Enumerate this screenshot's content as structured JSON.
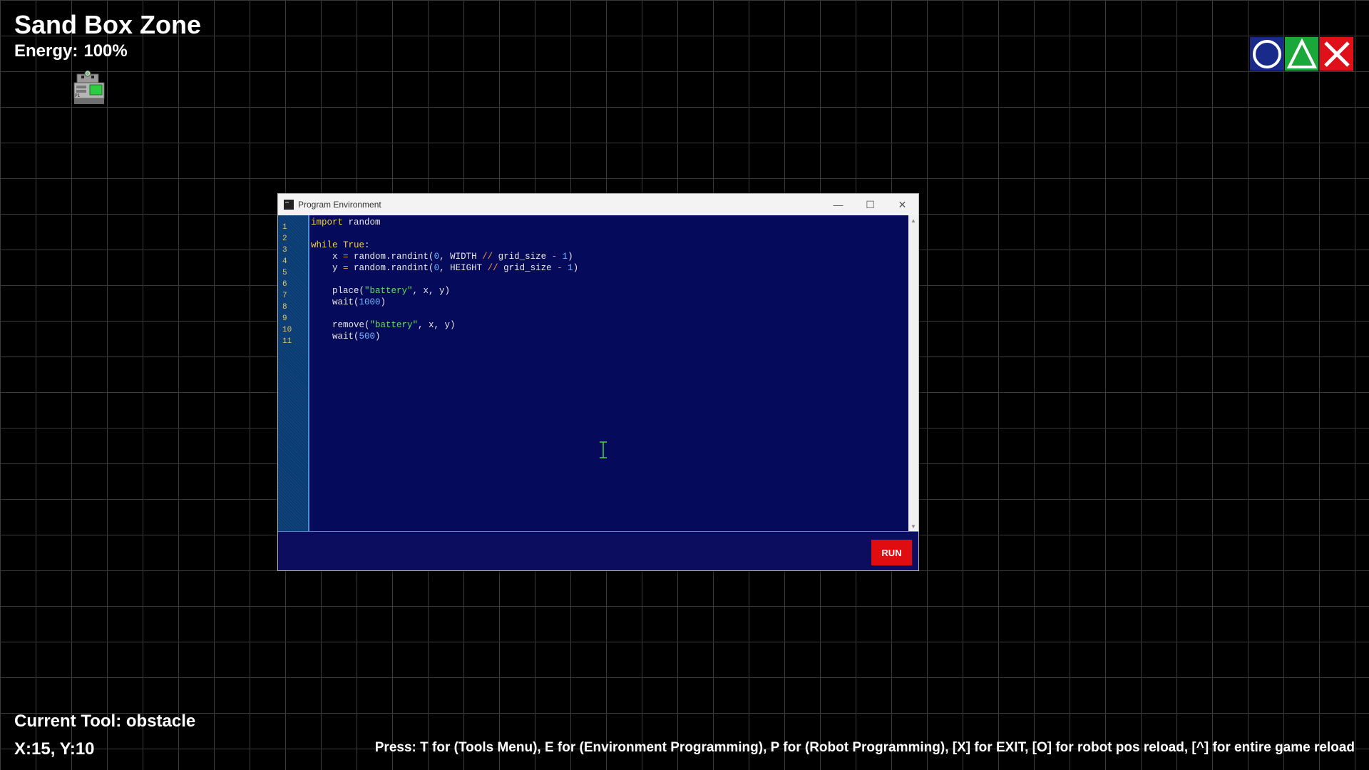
{
  "hud": {
    "title": "Sand Box Zone",
    "energy_label": "Energy:",
    "energy_value": "100%",
    "current_tool": "Current Tool: obstacle",
    "coords": "X:15, Y:10",
    "help": "Press: T for (Tools Menu), E for (Environment Programming), P for (Robot Programming), [X] for EXIT, [O] for robot pos reload, [^] for entire game reload"
  },
  "shape_buttons": [
    {
      "name": "circle",
      "color": "#1a2a8a"
    },
    {
      "name": "triangle",
      "color": "#1aa83a"
    },
    {
      "name": "cross",
      "color": "#e0101a"
    }
  ],
  "window": {
    "title": "Program Environment",
    "run_label": "RUN",
    "line_numbers": [
      "1",
      "2",
      "3",
      "4",
      "5",
      "6",
      "7",
      "8",
      "9",
      "10",
      "11"
    ],
    "code_lines": [
      "import random",
      "",
      "while True:",
      "    x = random.randint(0, WIDTH // grid_size - 1)",
      "    y = random.randint(0, HEIGHT // grid_size - 1)",
      "",
      "    place(\"battery\", x, y)",
      "    wait(1000)",
      "",
      "    remove(\"battery\", x, y)",
      "    wait(500)"
    ]
  },
  "colors": {
    "editor_bg": "#060a5a",
    "keyword": "#f2d04a",
    "string": "#5fe05f",
    "operator": "#f29a3a",
    "number": "#6fb6ff",
    "run_button": "#e00d10"
  }
}
